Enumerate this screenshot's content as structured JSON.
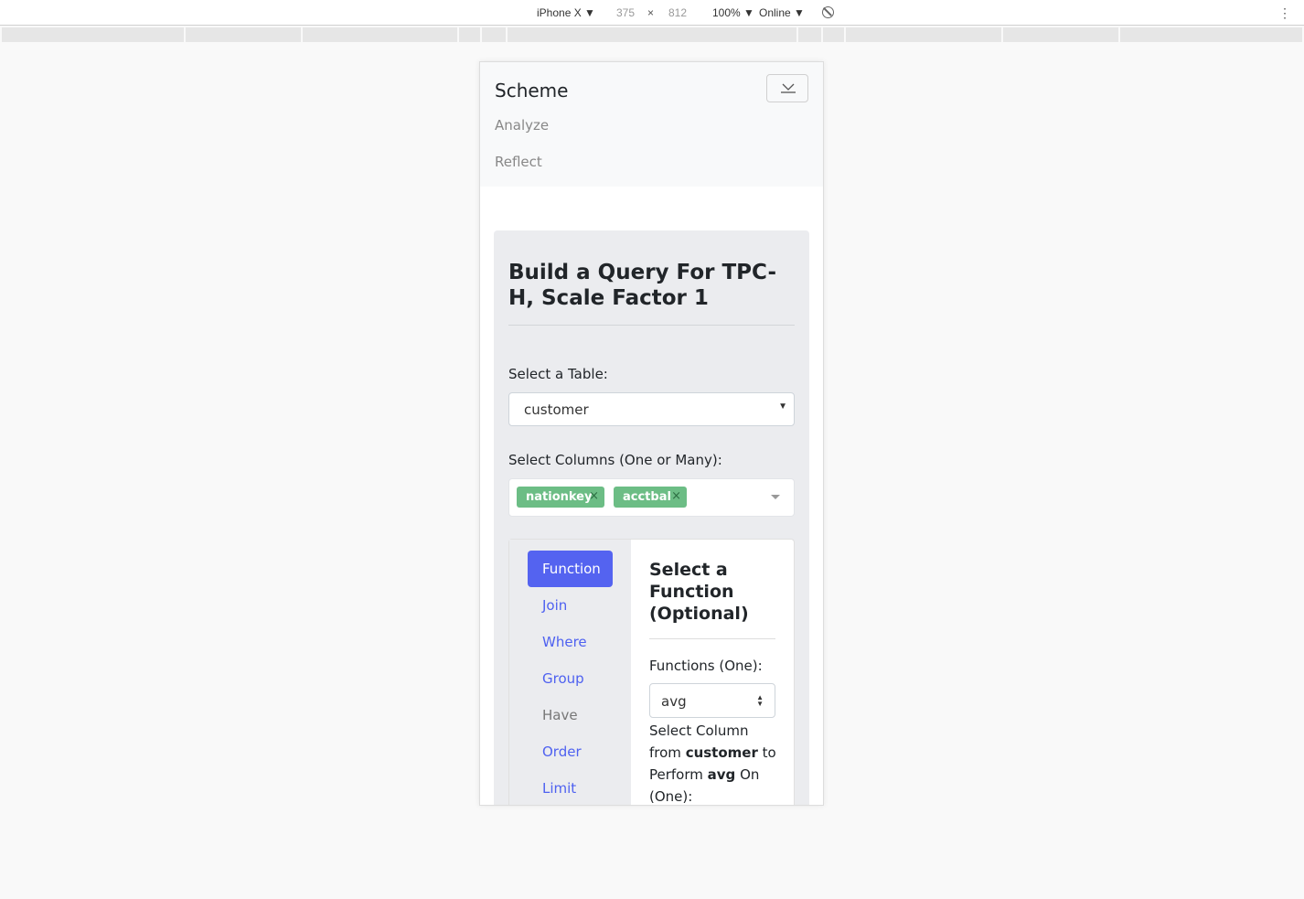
{
  "devtools": {
    "device": "iPhone X",
    "width": "375",
    "times": "×",
    "height": "812",
    "zoom": "100%",
    "network": "Online",
    "caret": "▼",
    "menu": "⋮"
  },
  "navbar": {
    "brand": "Scheme",
    "links": [
      "Analyze",
      "Reflect"
    ]
  },
  "builder": {
    "title_prefix": "Build a Query For ",
    "title_dataset": "TPC-H, Scale Factor 1",
    "table_label": "Select a Table:",
    "table_value": "customer",
    "columns_label": "Select Columns (One or Many):",
    "columns": [
      "nationkey",
      "acctbal"
    ],
    "chip_remove": "×"
  },
  "tabs": [
    {
      "label": "Function"
    },
    {
      "label": "Join"
    },
    {
      "label": "Where"
    },
    {
      "label": "Group"
    },
    {
      "label": "Have"
    },
    {
      "label": "Order"
    },
    {
      "label": "Limit"
    }
  ],
  "function_panel": {
    "title": "Select a Function (Optional)",
    "functions_label": "Functions (One):",
    "function_value": "avg",
    "desc_1": "Select Column from ",
    "desc_table": "customer",
    "desc_2": " to Perform ",
    "desc_fn": "avg",
    "desc_3": " On (One):"
  },
  "colors": {
    "primary": "#5463f0",
    "chip": "#6cbd85",
    "card_bg": "#ebecef"
  }
}
